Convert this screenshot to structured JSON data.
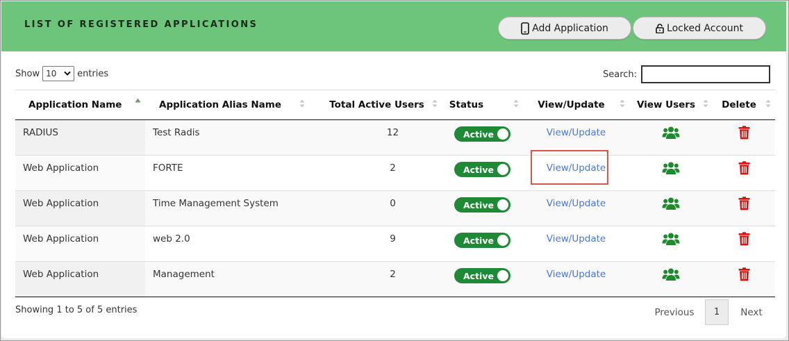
{
  "header": {
    "title": "LIST OF REGISTERED APPLICATIONS",
    "add_button_label": "Add Application",
    "locked_button_label": "Locked Account",
    "background_color": "#6cc57a"
  },
  "controls": {
    "show_label": "Show",
    "entries_label": "entries",
    "page_size": "10",
    "search_label": "Search:",
    "search_value": ""
  },
  "table": {
    "columns": [
      "Application Name",
      "Application Alias Name",
      "Total Active Users",
      "Status",
      "View/Update",
      "View Users",
      "Delete"
    ],
    "sorted_column": "Application Name",
    "rows": [
      {
        "name": "RADIUS",
        "alias": "Test Radis",
        "users": "12",
        "status": "Active",
        "view": "View/Update"
      },
      {
        "name": "Web Application",
        "alias": "FORTE",
        "users": "2",
        "status": "Active",
        "view": "View/Update"
      },
      {
        "name": "Web Application",
        "alias": "Time Management System",
        "users": "0",
        "status": "Active",
        "view": "View/Update"
      },
      {
        "name": "Web Application",
        "alias": "web 2.0",
        "users": "9",
        "status": "Active",
        "view": "View/Update"
      },
      {
        "name": "Web Application",
        "alias": "Management",
        "users": "2",
        "status": "Active",
        "view": "View/Update"
      }
    ],
    "icons": {
      "view_users": "users-group-icon",
      "delete": "trash-icon"
    },
    "colors": {
      "status_on": "#1f8a36",
      "users_icon": "#1e8a2e",
      "delete_icon": "#e01010",
      "link": "#4a76d9"
    }
  },
  "footer": {
    "info": "Showing 1 to 5 of 5 entries",
    "previous_label": "Previous",
    "current_page": "1",
    "next_label": "Next"
  }
}
